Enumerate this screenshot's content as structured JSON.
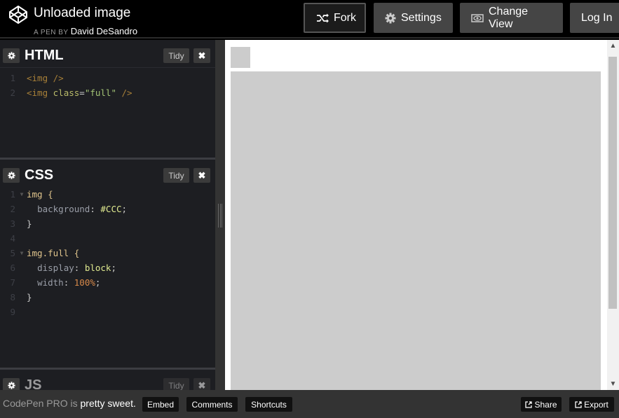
{
  "header": {
    "title": "Unloaded image",
    "byline_prefix": "A PEN BY",
    "author": "David DeSandro",
    "buttons": {
      "fork": "Fork",
      "settings": "Settings",
      "change_view": "Change View",
      "login": "Log In"
    },
    "icons": {
      "logo": "codepen-logo-icon",
      "fork": "fork-icon",
      "settings": "gear-icon",
      "change_view": "eye-icon"
    }
  },
  "editors": {
    "html": {
      "label": "HTML",
      "tidy": "Tidy",
      "close": "✖",
      "lines": [
        {
          "num": "1",
          "code": [
            "<img />"
          ]
        },
        {
          "num": "2",
          "code": [
            "<img ",
            "class",
            "=",
            "\"full\"",
            " />"
          ]
        }
      ]
    },
    "css": {
      "label": "CSS",
      "tidy": "Tidy",
      "close": "✖",
      "lines": [
        {
          "num": "1",
          "text": "img {"
        },
        {
          "num": "2",
          "prop": "background",
          "value": "#CCC"
        },
        {
          "num": "3",
          "text": "}"
        },
        {
          "num": "4",
          "text": ""
        },
        {
          "num": "5",
          "text": "img.full {"
        },
        {
          "num": "6",
          "prop": "display",
          "value": "block"
        },
        {
          "num": "7",
          "prop": "width",
          "value": "100%"
        },
        {
          "num": "8",
          "text": "}"
        },
        {
          "num": "9",
          "text": ""
        }
      ]
    },
    "js": {
      "label": "JS",
      "tidy": "Tidy",
      "close": "✖"
    }
  },
  "footer": {
    "promo_brand": "CodePen PRO",
    "promo_is": " is ",
    "promo_rest": "pretty sweet.",
    "buttons": {
      "embed": "Embed",
      "comments": "Comments",
      "shortcuts": "Shortcuts",
      "share": "Share",
      "export": "Export"
    }
  },
  "scrollbar": {
    "up": "▲",
    "down": "▼"
  }
}
